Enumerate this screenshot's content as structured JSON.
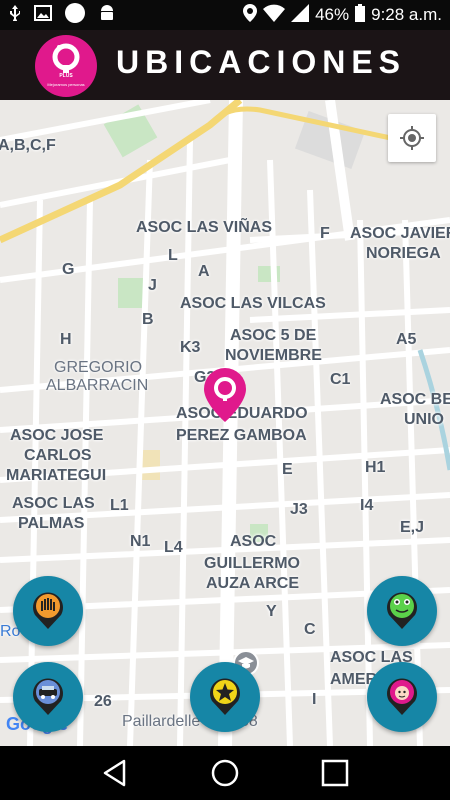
{
  "status_bar": {
    "battery": "46%",
    "time": "9:28 a.m.",
    "icons": [
      "usb-icon",
      "image-icon",
      "circle-icon",
      "android-icon",
      "location-icon",
      "wifi-icon",
      "signal-icon",
      "battery-icon"
    ]
  },
  "header": {
    "title": "UBICACIONES",
    "logo_text": "PLUS",
    "logo_sub": "Mejoramos personas"
  },
  "map": {
    "labels": [
      "A,B,C,F",
      "ASOC LAS VIÑAS",
      "F",
      "ASOC JAVIER",
      "NORIEGA",
      "G",
      "L",
      "A",
      "J",
      "ASOC LAS VILCAS",
      "B",
      "H",
      "ASOC 5 DE",
      "NOVIEMBRE",
      "K3",
      "A5",
      "GREGORIO",
      "ALBARRACIN",
      "G3",
      "C1",
      "ASOC BE",
      "UNIO",
      "ASOC EDUARDO",
      "PEREZ GAMBOA",
      "ASOC JOSE",
      "CARLOS",
      "MARIATEGUI",
      "E",
      "H1",
      "ASOC LAS",
      "PALMAS",
      "L1",
      "I4",
      "J3",
      "E,J",
      "N1",
      "L4",
      "ASOC",
      "GUILLERMO",
      "AUZA ARCE",
      "Y",
      "C",
      "ASOC LAS",
      "AMER",
      "26",
      "I",
      "Paillardelle",
      "58",
      "Ro"
    ],
    "google": "Google"
  },
  "fabs": [
    {
      "name": "fab-hand",
      "icon": "hand-icon"
    },
    {
      "name": "fab-frog",
      "icon": "frog-icon"
    },
    {
      "name": "fab-car",
      "icon": "car-icon"
    },
    {
      "name": "fab-star",
      "icon": "star-icon"
    },
    {
      "name": "fab-face",
      "icon": "face-icon"
    }
  ],
  "colors": {
    "header_bg": "#1b1416",
    "accent": "#e0198c",
    "fab": "#1686a6",
    "map_bg": "#ebe9e6"
  }
}
